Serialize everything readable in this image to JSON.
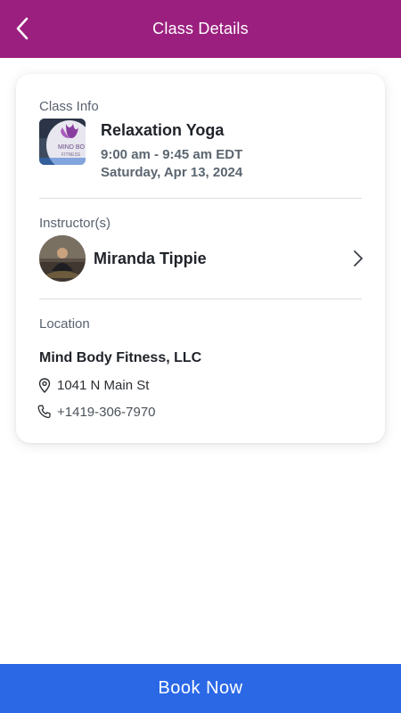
{
  "header": {
    "title": "Class Details",
    "back_icon": "chevron-left-icon",
    "background": "#9b1f7e"
  },
  "class_info": {
    "label": "Class Info",
    "name": "Relaxation Yoga",
    "time": "9:00 am - 9:45 am EDT",
    "date": "Saturday, Apr 13, 2024",
    "thumbnail_text": "MIND BODY FITNESS"
  },
  "instructor": {
    "label": "Instructor(s)",
    "name": "Miranda Tippie",
    "chevron_icon": "chevron-right-icon"
  },
  "location": {
    "label": "Location",
    "name": "Mind Body Fitness, LLC",
    "address": "1041 N Main St",
    "address_icon": "map-pin-icon",
    "phone": "+1419-306-7970",
    "phone_icon": "phone-icon"
  },
  "footer": {
    "book_label": "Book Now",
    "button_color": "#2a68e6"
  }
}
